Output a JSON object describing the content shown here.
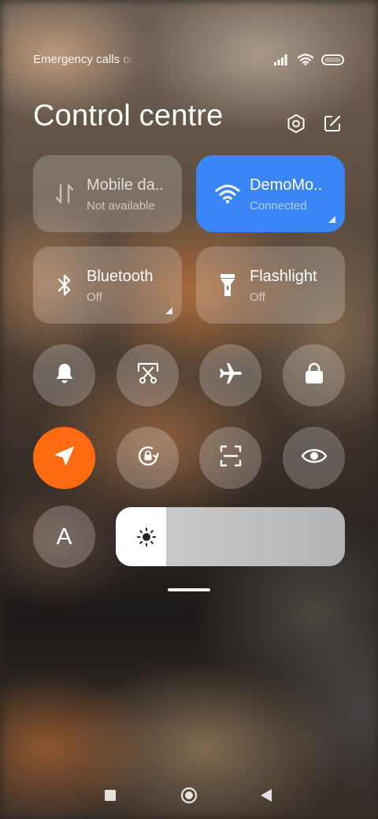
{
  "status_bar": {
    "carrier_text": "Emergency calls only",
    "signal_icon": "signal-bars-icon",
    "wifi_icon": "wifi-icon",
    "battery_icon": "battery-icon"
  },
  "header": {
    "title": "Control centre",
    "settings_icon": "gear-icon",
    "edit_icon": "edit-icon"
  },
  "tiles": [
    {
      "title": "Mobile da..",
      "subtitle": "Not available",
      "icon": "mobile-data-icon",
      "state": "unavailable"
    },
    {
      "title": "DemoMo..",
      "subtitle": "Connected",
      "icon": "wifi-icon",
      "state": "on"
    },
    {
      "title": "Bluetooth",
      "subtitle": "Off",
      "icon": "bluetooth-icon",
      "state": "off"
    },
    {
      "title": "Flashlight",
      "subtitle": "Off",
      "icon": "flashlight-icon",
      "state": "off"
    }
  ],
  "toggles_row1": [
    {
      "icon": "bell-icon",
      "state": "off"
    },
    {
      "icon": "screenshot-icon",
      "state": "off"
    },
    {
      "icon": "airplane-icon",
      "state": "off"
    },
    {
      "icon": "lock-icon",
      "state": "off"
    }
  ],
  "toggles_row2": [
    {
      "icon": "location-icon",
      "state": "on"
    },
    {
      "icon": "rotation-lock-icon",
      "state": "off"
    },
    {
      "icon": "scan-icon",
      "state": "off"
    },
    {
      "icon": "eye-icon",
      "state": "off"
    }
  ],
  "font_toggle": {
    "label": "A",
    "icon": "font-size-icon"
  },
  "brightness": {
    "level": 0.22,
    "icon": "sun-icon"
  },
  "colors": {
    "wifi_active": "#3b86f7",
    "location_active": "#ff6a13",
    "tile_bg": "rgba(255,255,255,0.20)"
  },
  "nav_bar": {
    "recents_icon": "square-icon",
    "home_icon": "circle-icon",
    "back_icon": "triangle-back-icon"
  }
}
